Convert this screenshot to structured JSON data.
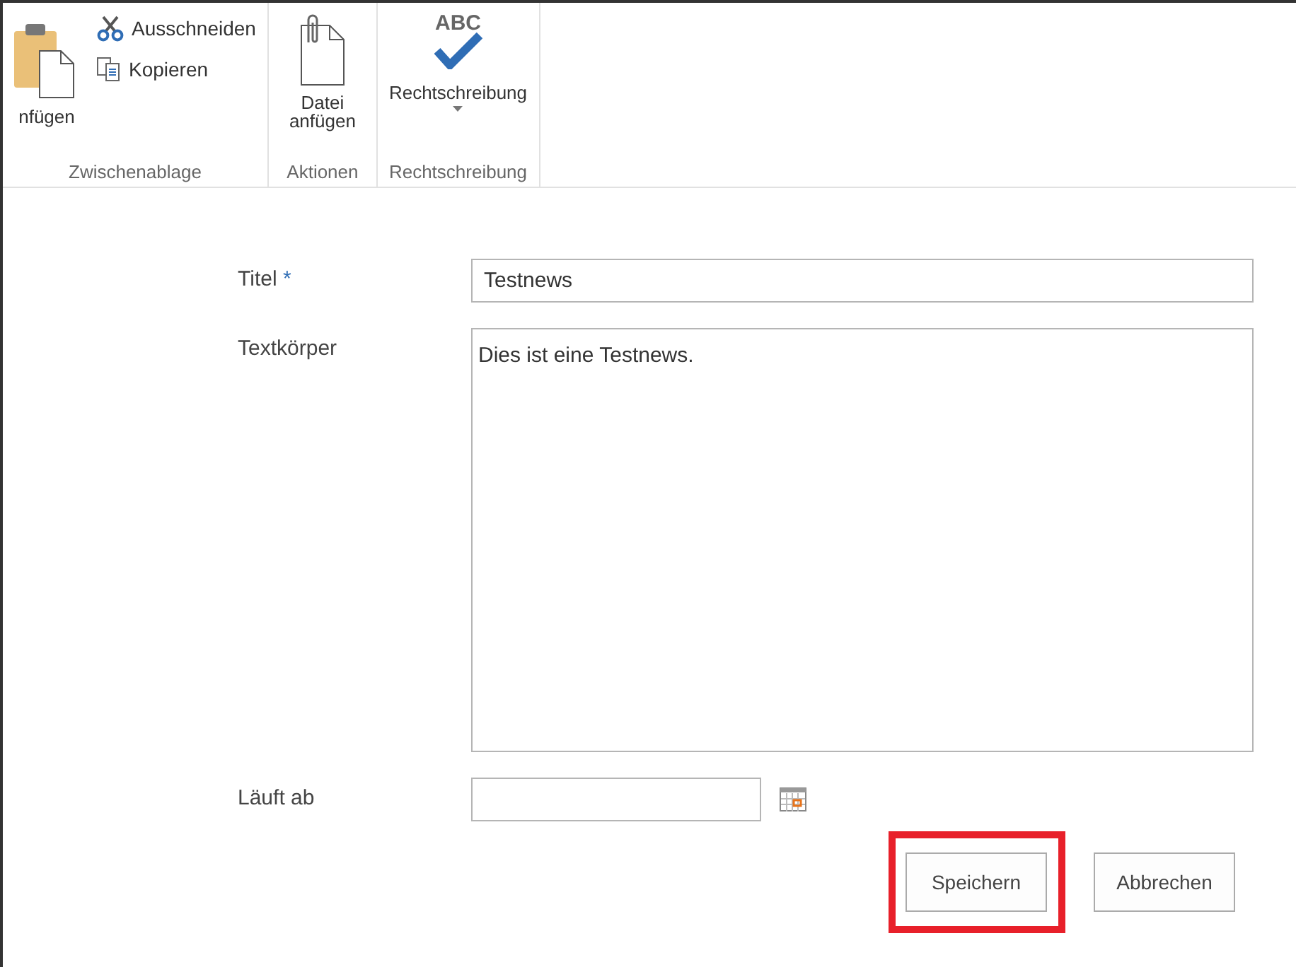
{
  "ribbon": {
    "groups": [
      {
        "label": "Zwischenablage",
        "large": {
          "label": "nfügen"
        },
        "small": [
          {
            "label": "Ausschneiden"
          },
          {
            "label": "Kopieren"
          }
        ]
      },
      {
        "label": "Aktionen",
        "large": {
          "label": "Datei anfügen"
        }
      },
      {
        "label": "Rechtschreibung",
        "large": {
          "label": "Rechtschreibung",
          "icon_text": "ABC",
          "dropdown": true
        }
      }
    ]
  },
  "form": {
    "fields": [
      {
        "label": "Titel",
        "required_mark": "*",
        "kind": "text",
        "value": "Testnews"
      },
      {
        "label": "Textkörper",
        "kind": "textarea",
        "value": "Dies ist eine Testnews."
      },
      {
        "label": "Läuft ab",
        "kind": "date"
      }
    ],
    "buttons": [
      {
        "label": "Speichern",
        "highlighted": true
      },
      {
        "label": "Abbrechen",
        "highlighted": false
      }
    ]
  }
}
